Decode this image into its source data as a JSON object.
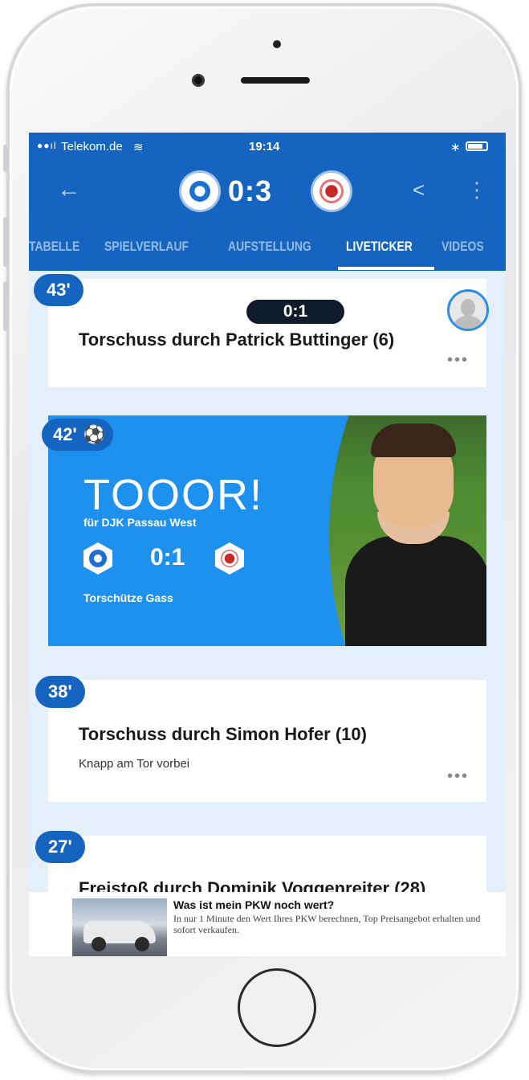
{
  "statusbar": {
    "carrier": "Telekom.de",
    "time": "19:14"
  },
  "header": {
    "score": "0:3",
    "back_icon": "arrow-left-icon",
    "share_icon": "share-icon",
    "more_icon": "more-vert-icon"
  },
  "tabs": [
    {
      "label": "TABELLE",
      "active": false
    },
    {
      "label": "SPIELVERLAUF",
      "active": false
    },
    {
      "label": "AUFSTELLUNG",
      "active": false
    },
    {
      "label": "LIVETICKER",
      "active": true
    },
    {
      "label": "VIDEOS",
      "active": false
    }
  ],
  "feed": {
    "event_43": {
      "minute": "43'",
      "score_pill": "0:1",
      "title": "Torschuss durch Patrick Buttinger (6)"
    },
    "goal_42": {
      "minute": "42'",
      "headline": "TOOOR!",
      "for_team": "für DJK Passau West",
      "score": "0:1",
      "scorer": "Torschütze Gass"
    },
    "event_38": {
      "minute": "38'",
      "title": "Torschuss durch Simon Hofer (10)",
      "subtitle": "Knapp am Tor vorbei"
    },
    "event_27": {
      "minute": "27'",
      "title": "Freistoß durch Dominik Voggenreiter (28)"
    }
  },
  "ad": {
    "title": "Was ist mein PKW noch wert?",
    "text": "In nur 1 Minute den Wert Ihres PKW berechnen, Top Preisangebot erhalten und sofort verkaufen."
  },
  "colors": {
    "primary": "#1565c0",
    "goal_card": "#1e90ee",
    "screen_bg": "#e4effa"
  }
}
